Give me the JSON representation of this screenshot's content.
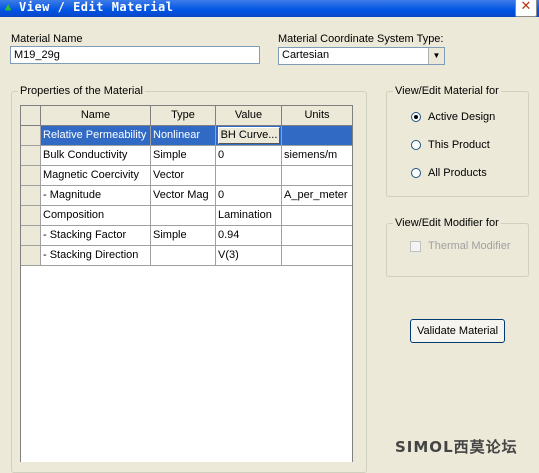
{
  "window": {
    "title": "View / Edit Material",
    "close_glyph": "✕"
  },
  "material_name": {
    "label": "Material Name",
    "value": "M19_29g"
  },
  "coordinate_system": {
    "label": "Material Coordinate System Type:",
    "value": "Cartesian"
  },
  "properties": {
    "group_label": "Properties of the Material",
    "columns": [
      "Name",
      "Type",
      "Value",
      "Units"
    ],
    "rows": [
      {
        "name": "Relative Permeability",
        "type": "Nonlinear",
        "value": "BH Curve...",
        "units": ""
      },
      {
        "name": "Bulk Conductivity",
        "type": "Simple",
        "value": "0",
        "units": "siemens/m"
      },
      {
        "name": "Magnetic Coercivity",
        "type": "Vector",
        "value": "",
        "units": ""
      },
      {
        "name": "-  Magnitude",
        "type": "Vector Mag",
        "value": "0",
        "units": "A_per_meter"
      },
      {
        "name": "Composition",
        "type": "",
        "value": "Lamination",
        "units": ""
      },
      {
        "name": "- Stacking Factor",
        "type": "Simple",
        "value": "0.94",
        "units": ""
      },
      {
        "name": "- Stacking Direction",
        "type": "",
        "value": "V(3)",
        "units": ""
      }
    ]
  },
  "view_edit_for": {
    "group_label": "View/Edit Material for",
    "options": [
      {
        "label": "Active Design",
        "checked": true
      },
      {
        "label": "This Product",
        "checked": false
      },
      {
        "label": "All Products",
        "checked": false
      }
    ]
  },
  "modifier": {
    "group_label": "View/Edit Modifier for",
    "thermal_label": "Thermal Modifier",
    "thermal_checked": false
  },
  "validate_button": "Validate Material",
  "watermark": "SIMOL西莫论坛",
  "colors": {
    "selection": "#316ac5",
    "titlebar": "#0054e3"
  }
}
